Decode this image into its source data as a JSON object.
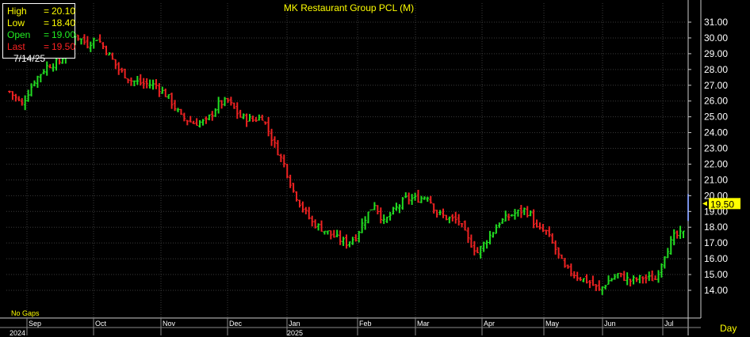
{
  "chart_data": {
    "type": "ohlc",
    "title": "MK Restaurant Group PCL  (M)",
    "interval_label": "Day",
    "gaps_label": "No Gaps",
    "last_price_label": "19.50",
    "ylim": [
      13.0,
      32.0
    ],
    "y_ticks": [
      "14.00",
      "15.00",
      "16.00",
      "17.00",
      "18.00",
      "19.00",
      "20.00",
      "21.00",
      "22.00",
      "23.00",
      "24.00",
      "25.00",
      "26.00",
      "27.00",
      "28.00",
      "29.00",
      "30.00",
      "31.00"
    ],
    "x_month_labels": [
      "Sep",
      "Oct",
      "Nov",
      "Dec",
      "Jan",
      "Feb",
      "Mar",
      "Apr",
      "May",
      "Jun",
      "Jul"
    ],
    "x_year_labels": [
      "2024",
      "2025"
    ],
    "colors": {
      "background": "#000000",
      "up": "#22dd22",
      "down": "#ee2222",
      "grid": "#3a3a3a",
      "title": "#ffff00",
      "axis_text": "#ffffff",
      "last_tag": "#ffff00"
    },
    "close_path": [
      [
        0,
        26.6
      ],
      [
        4,
        25.8
      ],
      [
        8,
        27.3
      ],
      [
        12,
        28.2
      ],
      [
        16,
        28.5
      ],
      [
        18,
        29.0
      ],
      [
        21,
        30.2
      ],
      [
        25,
        29.6
      ],
      [
        28,
        30.0
      ],
      [
        31,
        29.2
      ],
      [
        35,
        28.0
      ],
      [
        39,
        27.3
      ],
      [
        43,
        27.1
      ],
      [
        47,
        27.0
      ],
      [
        51,
        26.2
      ],
      [
        55,
        25.0
      ],
      [
        59,
        24.6
      ],
      [
        63,
        24.7
      ],
      [
        67,
        25.8
      ],
      [
        70,
        26.0
      ],
      [
        74,
        25.0
      ],
      [
        78,
        24.8
      ],
      [
        81,
        25.0
      ],
      [
        85,
        23.2
      ],
      [
        88,
        22.0
      ],
      [
        91,
        20.3
      ],
      [
        94,
        19.2
      ],
      [
        97,
        18.3
      ],
      [
        101,
        17.8
      ],
      [
        104,
        17.4
      ],
      [
        108,
        17.0
      ],
      [
        111,
        17.4
      ],
      [
        114,
        18.6
      ],
      [
        117,
        19.5
      ],
      [
        120,
        18.3
      ],
      [
        123,
        19.0
      ],
      [
        127,
        19.8
      ],
      [
        131,
        19.8
      ],
      [
        134,
        20.0
      ],
      [
        137,
        18.9
      ],
      [
        140,
        18.6
      ],
      [
        144,
        18.4
      ],
      [
        147,
        17.2
      ],
      [
        150,
        16.4
      ],
      [
        153,
        17.2
      ],
      [
        157,
        18.3
      ],
      [
        161,
        18.8
      ],
      [
        165,
        19.1
      ],
      [
        167,
        18.8
      ],
      [
        169,
        17.9
      ],
      [
        172,
        17.7
      ],
      [
        175,
        16.6
      ],
      [
        178,
        15.4
      ],
      [
        182,
        14.9
      ],
      [
        186,
        14.5
      ],
      [
        189,
        14.0
      ],
      [
        192,
        14.6
      ],
      [
        195,
        15.0
      ],
      [
        199,
        14.6
      ],
      [
        203,
        14.8
      ],
      [
        207,
        14.7
      ],
      [
        210,
        16.3
      ],
      [
        213,
        17.4
      ],
      [
        216,
        17.6
      ]
    ],
    "series_samples": [
      {
        "date": "7/14/25",
        "high": 20.1,
        "low": 18.4,
        "open": 19.0,
        "last": 19.5
      }
    ],
    "ohlc_readout": {
      "rows": [
        {
          "label": "High",
          "value": "20.10",
          "color": "#ffff00"
        },
        {
          "label": "Low",
          "value": "18.40",
          "color": "#ffff00"
        },
        {
          "label": "Open",
          "value": "19.00",
          "color": "#22ee22"
        },
        {
          "label": "Last",
          "value": "19.50",
          "color": "#ff2222"
        }
      ],
      "date": "7/14/25"
    }
  }
}
